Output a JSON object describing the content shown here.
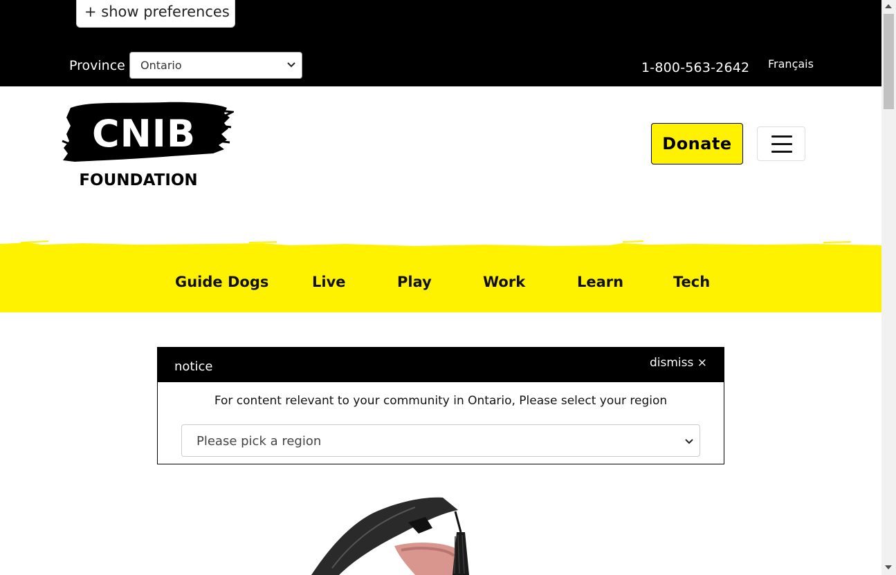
{
  "preferences": {
    "label": "+ show preferences"
  },
  "topbar": {
    "province_label": "Province",
    "province_value": "Ontario",
    "phone": "1-800-563-2642",
    "language": "Français"
  },
  "logo": {
    "text_top": "CNIB",
    "text_bottom": "FOUNDATION"
  },
  "header": {
    "donate_label": "Donate"
  },
  "nav": {
    "items": [
      "Guide Dogs",
      "Live",
      "Play",
      "Work",
      "Learn",
      "Tech"
    ]
  },
  "notice": {
    "title": "notice",
    "dismiss_label": "dismiss ×",
    "message": "For content relevant to your community in Ontario, Please select your region",
    "region_placeholder": "Please pick a region"
  },
  "colors": {
    "accent": "#fff200",
    "topbar": "#000000"
  },
  "icons": [
    "chevron-down-icon",
    "hamburger-menu-icon",
    "close-icon"
  ]
}
